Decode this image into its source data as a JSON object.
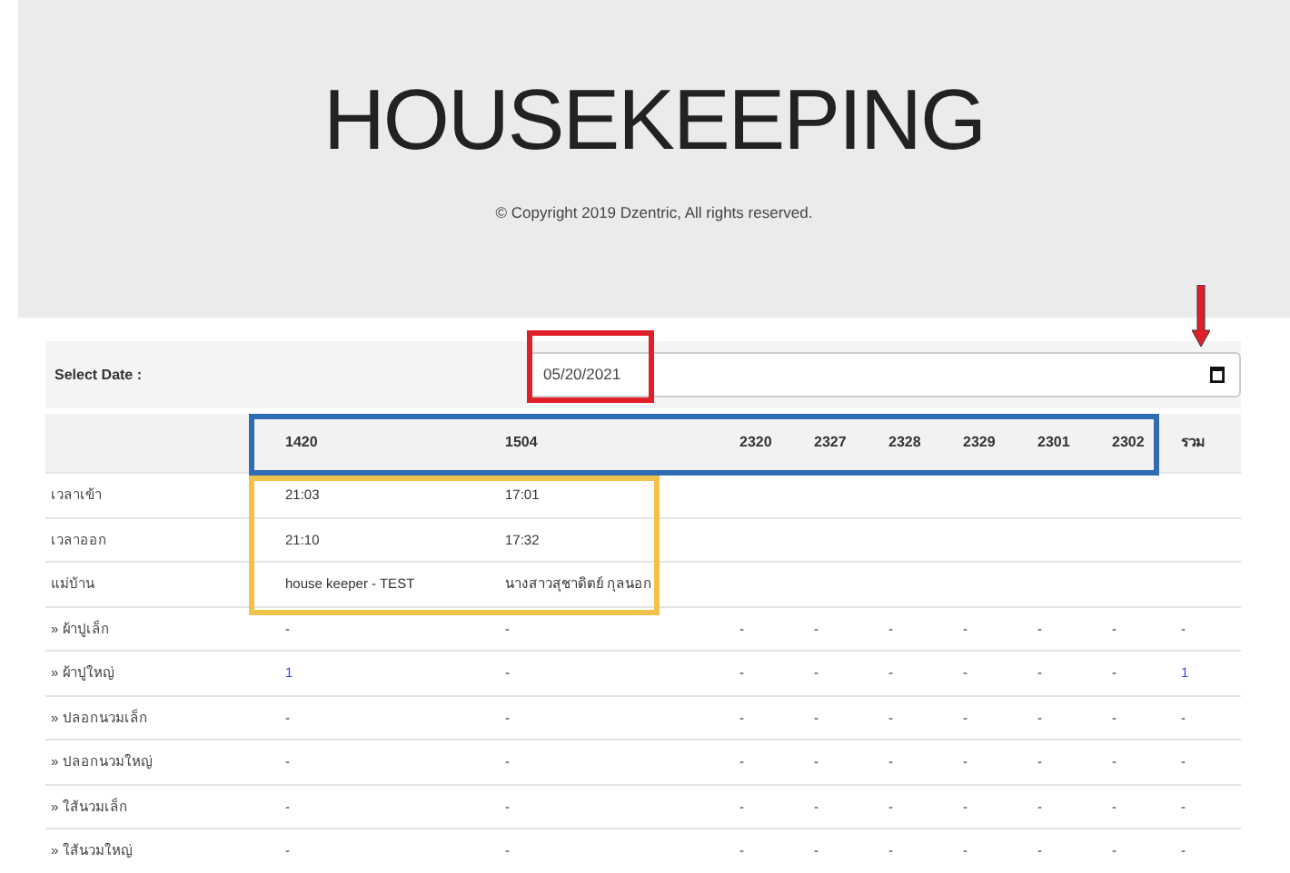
{
  "header": {
    "title": "HOUSEKEEPING",
    "copyright": "© Copyright 2019 Dzentric, All rights reserved."
  },
  "date_filter": {
    "label": "Select Date :",
    "value": "05/20/2021"
  },
  "table": {
    "columns": [
      "1420",
      "1504",
      "2320",
      "2327",
      "2328",
      "2329",
      "2301",
      "2302",
      "รวม"
    ],
    "rows": [
      {
        "label": "เวลาเข้า",
        "cells": [
          {
            "text": "21:03",
            "link": false
          },
          {
            "text": "17:01",
            "link": false
          }
        ]
      },
      {
        "label": "เวลาออก",
        "cells": [
          {
            "text": "21:10",
            "link": false
          },
          {
            "text": "17:32",
            "link": false
          }
        ]
      },
      {
        "label": "แม่บ้าน",
        "cells": [
          {
            "text": "house keeper - TEST",
            "link": false
          },
          {
            "text": "นางสาวสุชาดิตย์ กุลนอก",
            "link": false
          }
        ]
      },
      {
        "label": "» ผ้าปูเล็ก",
        "cells": [
          {
            "text": "-",
            "link": false
          },
          {
            "text": "-",
            "link": false
          },
          {
            "text": "-",
            "link": false
          },
          {
            "text": "-",
            "link": false
          },
          {
            "text": "-",
            "link": false
          },
          {
            "text": "-",
            "link": false
          },
          {
            "text": "-",
            "link": false
          },
          {
            "text": "-",
            "link": false
          },
          {
            "text": "-",
            "link": false
          }
        ]
      },
      {
        "label": "» ผ้าปูใหญ่",
        "cells": [
          {
            "text": "1",
            "link": true
          },
          {
            "text": "-",
            "link": false
          },
          {
            "text": "-",
            "link": false
          },
          {
            "text": "-",
            "link": false
          },
          {
            "text": "-",
            "link": false
          },
          {
            "text": "-",
            "link": false
          },
          {
            "text": "-",
            "link": false
          },
          {
            "text": "-",
            "link": false
          },
          {
            "text": "1",
            "link": true
          }
        ]
      },
      {
        "label": "» ปลอกนวมเล็ก",
        "cells": [
          {
            "text": "-",
            "link": false
          },
          {
            "text": "-",
            "link": false
          },
          {
            "text": "-",
            "link": false
          },
          {
            "text": "-",
            "link": false
          },
          {
            "text": "-",
            "link": false
          },
          {
            "text": "-",
            "link": false
          },
          {
            "text": "-",
            "link": false
          },
          {
            "text": "-",
            "link": false
          },
          {
            "text": "-",
            "link": false
          }
        ]
      },
      {
        "label": "» ปลอกนวมใหญ่",
        "cells": [
          {
            "text": "-",
            "link": false
          },
          {
            "text": "-",
            "link": false
          },
          {
            "text": "-",
            "link": false
          },
          {
            "text": "-",
            "link": false
          },
          {
            "text": "-",
            "link": false
          },
          {
            "text": "-",
            "link": false
          },
          {
            "text": "-",
            "link": false
          },
          {
            "text": "-",
            "link": false
          },
          {
            "text": "-",
            "link": false
          }
        ]
      },
      {
        "label": "» ใส้นวมเล็ก",
        "cells": [
          {
            "text": "-",
            "link": false
          },
          {
            "text": "-",
            "link": false
          },
          {
            "text": "-",
            "link": false
          },
          {
            "text": "-",
            "link": false
          },
          {
            "text": "-",
            "link": false
          },
          {
            "text": "-",
            "link": false
          },
          {
            "text": "-",
            "link": false
          },
          {
            "text": "-",
            "link": false
          },
          {
            "text": "-",
            "link": false
          }
        ]
      },
      {
        "label": "» ใส้นวมใหญ่",
        "cells": [
          {
            "text": "-",
            "link": false
          },
          {
            "text": "-",
            "link": false
          },
          {
            "text": "-",
            "link": false
          },
          {
            "text": "-",
            "link": false
          },
          {
            "text": "-",
            "link": false
          },
          {
            "text": "-",
            "link": false
          },
          {
            "text": "-",
            "link": false
          },
          {
            "text": "-",
            "link": false
          },
          {
            "text": "-",
            "link": false
          }
        ]
      }
    ]
  },
  "annotations": [
    {
      "kind": "box",
      "color": "#e02028"
    },
    {
      "kind": "box",
      "color": "#2f6cb3"
    },
    {
      "kind": "box",
      "color": "#f0c24a"
    },
    {
      "kind": "arrow",
      "color": "#e02028"
    }
  ]
}
